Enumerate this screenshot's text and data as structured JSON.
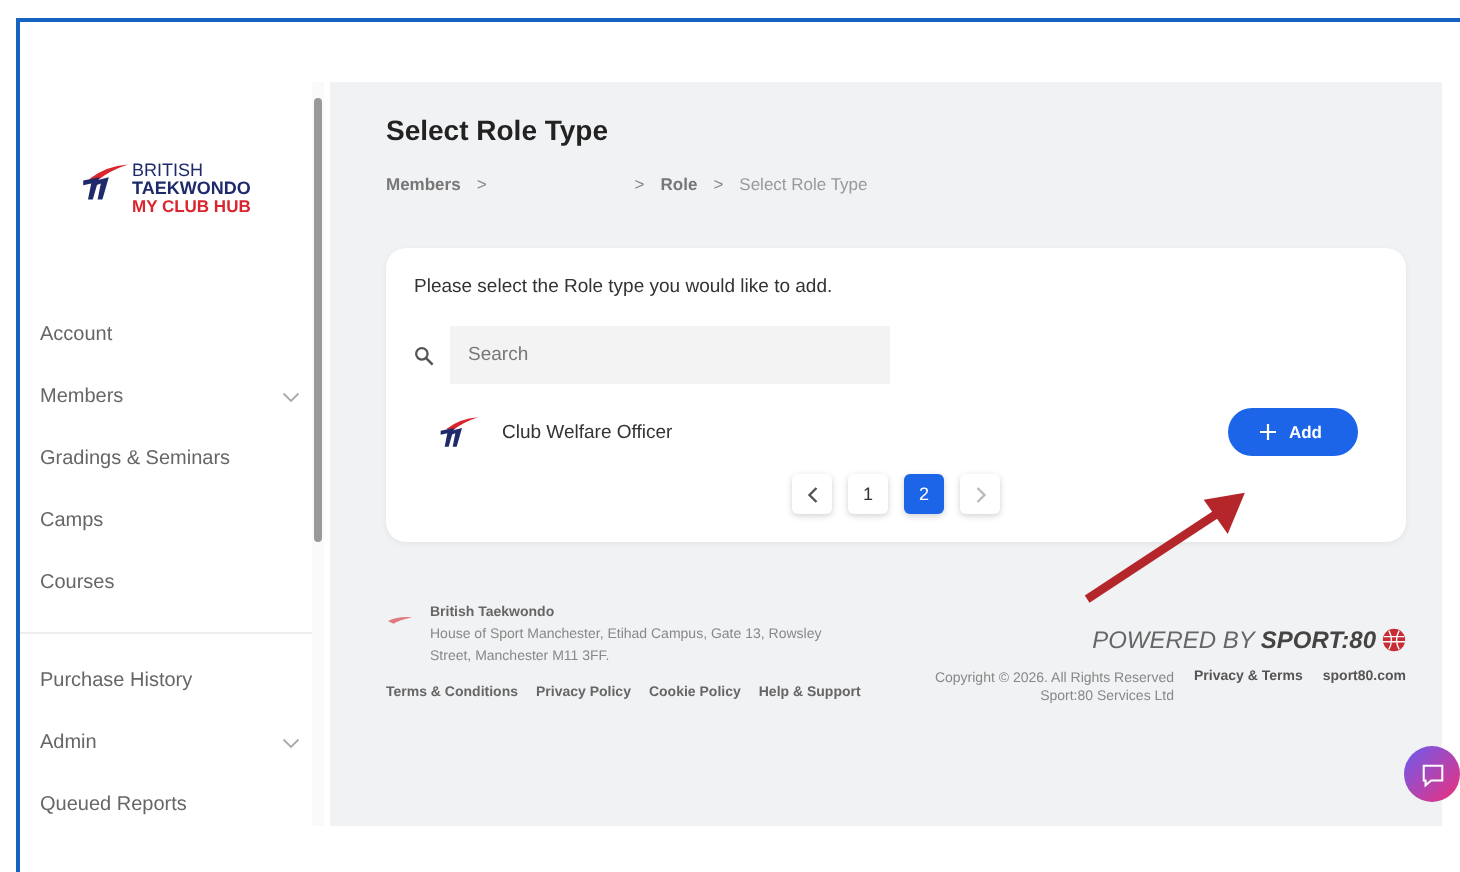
{
  "sidebar": {
    "logo": {
      "line_1": "BRITISH",
      "line_2": "TAEKWONDO",
      "line_3": "MY CLUB HUB"
    },
    "groups": [
      [
        {
          "label": "Account",
          "kind": "link"
        },
        {
          "label": "Members",
          "kind": "expandable"
        },
        {
          "label": "Gradings & Seminars",
          "kind": "link"
        },
        {
          "label": "Camps",
          "kind": "link"
        },
        {
          "label": "Courses",
          "kind": "link"
        }
      ],
      [
        {
          "label": "Purchase History",
          "kind": "link"
        },
        {
          "label": "Admin",
          "kind": "expandable"
        },
        {
          "label": "Queued Reports",
          "kind": "link"
        }
      ]
    ]
  },
  "page": {
    "title": "Select Role Type",
    "breadcrumb": [
      {
        "label": "Members",
        "kind": "link"
      },
      {
        "label": ">",
        "kind": "separator"
      },
      {
        "label": ">",
        "kind": "separator",
        "gap_before": true
      },
      {
        "label": "Role",
        "kind": "link"
      },
      {
        "label": ">",
        "kind": "separator"
      },
      {
        "label": "Select Role Type",
        "kind": "current"
      }
    ]
  },
  "card": {
    "prompt": "Please select the Role type you would like to add.",
    "search": {
      "placeholder": "Search"
    },
    "roles": [
      {
        "name": "Club Welfare Officer",
        "button": "Add"
      }
    ],
    "pagination": [
      {
        "label": "1",
        "selected": false
      },
      {
        "label": "2",
        "selected": true
      }
    ]
  },
  "footer": {
    "org_name": "British Taekwondo",
    "address": "House of Sport Manchester, Etihad Campus, Gate 13, Rowsley Street, Manchester M11 3FF.",
    "links": [
      "Terms & Conditions",
      "Privacy Policy",
      "Cookie Policy",
      "Help & Support"
    ],
    "powered_by": "POWERED BY",
    "brand": "SPORT:80",
    "copyright": "Copyright © 2026. All Rights Reserved Sport:80 Services Ltd",
    "right_links": [
      "Privacy & Terms",
      "sport80.com"
    ]
  }
}
